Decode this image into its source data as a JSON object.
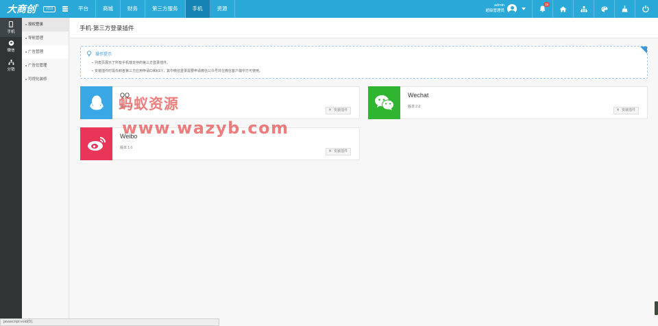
{
  "header": {
    "logo_text": "大商创",
    "logo_reg": "®",
    "logo_version": "V2.0",
    "nav": [
      "平台",
      "商城",
      "财务",
      "第三方服务",
      "手机",
      "资源"
    ],
    "active_nav_index": 4,
    "user_name": "admin",
    "user_role": "超级管理员",
    "notification_count": "15",
    "icons": [
      "bell-icon",
      "home-icon",
      "sitemap-icon",
      "palette-icon",
      "broom-icon",
      "power-icon"
    ]
  },
  "sidebar": {
    "items": [
      {
        "label": "手机",
        "icon": "mobile-icon"
      },
      {
        "label": "微信",
        "icon": "wechat-icon"
      },
      {
        "label": "分销",
        "icon": "hierarchy-icon"
      }
    ]
  },
  "submenu": {
    "items": [
      "授权登录",
      "导航管理",
      "广告管理",
      "广告位管理",
      "可视化装修"
    ]
  },
  "page": {
    "title": "手机-第三方登录插件"
  },
  "tips": {
    "title": "操作提示",
    "lines": [
      "列表页展示了所有手机端支持的第三方登录插件。",
      "安装插件时需先到各第三方应用申请ID和KEY，其中微信登录需要申请微信公众号并在微信客户端中方可使用。"
    ]
  },
  "plugins": [
    {
      "name": "QQ",
      "version": "版本:1.0",
      "install_label": "安装插件",
      "color": "#3aa7e6",
      "icon": "qq-icon"
    },
    {
      "name": "Wechat",
      "version": "版本:2.0",
      "install_label": "安装插件",
      "color": "#2fb52f",
      "icon": "wechat-icon"
    },
    {
      "name": "Weibo",
      "version": "版本:1.0",
      "install_label": "安装插件",
      "color": "#e93557",
      "icon": "weibo-icon"
    }
  ],
  "watermark": {
    "line1": "蚂蚁资源",
    "line2": "www.wazyb.com"
  },
  "statusbar": {
    "text": "javascript:void(0);"
  }
}
